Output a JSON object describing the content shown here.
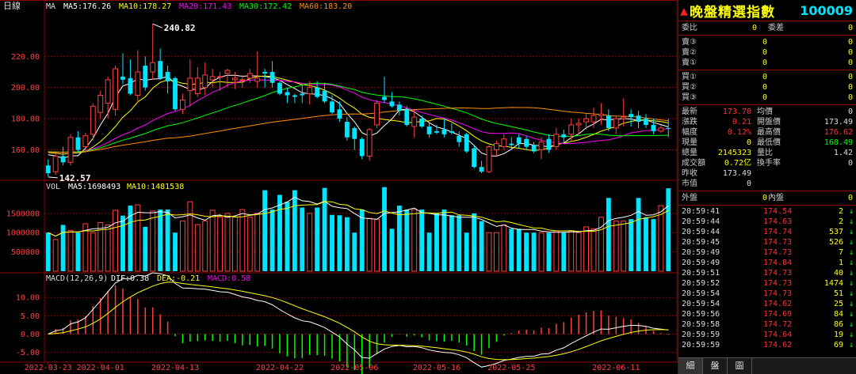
{
  "chart_data": {
    "type": "candlestick",
    "price_chart": {
      "period_label": "日線",
      "indicator_label": "MA",
      "ma_legend": [
        {
          "label": "MA5:176.26",
          "color": "#ffffff"
        },
        {
          "label": "MA10:178.27",
          "color": "#ffff00"
        },
        {
          "label": "MA20:171.43",
          "color": "#ff00ff"
        },
        {
          "label": "MA30:172.42",
          "color": "#00ff00"
        },
        {
          "label": "MA60:183.20",
          "color": "#ff8c00"
        }
      ],
      "ylim": [
        142,
        246
      ],
      "yticks": [
        160,
        180,
        200,
        220
      ],
      "ytick_labels": [
        "160.00",
        "180.00",
        "200.00",
        "220.00"
      ],
      "high_annotation": {
        "label": "240.82",
        "value": 240.82,
        "index": 14
      },
      "low_annotation": {
        "label": "142.57",
        "value": 142.57,
        "index": 0
      },
      "candles": [
        {
          "o": 150,
          "h": 154,
          "l": 143,
          "c": 145
        },
        {
          "o": 146,
          "h": 158,
          "l": 144,
          "c": 156
        },
        {
          "o": 156,
          "h": 162,
          "l": 150,
          "c": 152
        },
        {
          "o": 152,
          "h": 170,
          "l": 150,
          "c": 168
        },
        {
          "o": 168,
          "h": 172,
          "l": 158,
          "c": 160
        },
        {
          "o": 162,
          "h": 171,
          "l": 158,
          "c": 169
        },
        {
          "o": 170,
          "h": 190,
          "l": 166,
          "c": 188
        },
        {
          "o": 184,
          "h": 198,
          "l": 180,
          "c": 195
        },
        {
          "o": 190,
          "h": 207,
          "l": 180,
          "c": 205
        },
        {
          "o": 186,
          "h": 214,
          "l": 182,
          "c": 212
        },
        {
          "o": 207,
          "h": 222,
          "l": 202,
          "c": 205
        },
        {
          "o": 206,
          "h": 218,
          "l": 195,
          "c": 196
        },
        {
          "o": 195,
          "h": 224,
          "l": 190,
          "c": 210
        },
        {
          "o": 214,
          "h": 220,
          "l": 198,
          "c": 200
        },
        {
          "o": 210,
          "h": 241,
          "l": 205,
          "c": 216
        },
        {
          "o": 217,
          "h": 225,
          "l": 205,
          "c": 206
        },
        {
          "o": 210,
          "h": 214,
          "l": 196,
          "c": 204
        },
        {
          "o": 206,
          "h": 207,
          "l": 185,
          "c": 186
        },
        {
          "o": 186,
          "h": 196,
          "l": 183,
          "c": 192
        },
        {
          "o": 198,
          "h": 218,
          "l": 188,
          "c": 206
        },
        {
          "o": 196,
          "h": 213,
          "l": 194,
          "c": 206
        },
        {
          "o": 200,
          "h": 216,
          "l": 195,
          "c": 208
        },
        {
          "o": 205,
          "h": 212,
          "l": 200,
          "c": 207
        },
        {
          "o": 207,
          "h": 210,
          "l": 198,
          "c": 207
        },
        {
          "o": 209,
          "h": 212,
          "l": 200,
          "c": 211
        },
        {
          "o": 205,
          "h": 210,
          "l": 199,
          "c": 206
        },
        {
          "o": 205,
          "h": 208,
          "l": 200,
          "c": 205
        },
        {
          "o": 206,
          "h": 212,
          "l": 203,
          "c": 209
        },
        {
          "o": 204,
          "h": 223,
          "l": 200,
          "c": 206
        },
        {
          "o": 210,
          "h": 212,
          "l": 200,
          "c": 209
        },
        {
          "o": 210,
          "h": 217,
          "l": 200,
          "c": 203
        },
        {
          "o": 203,
          "h": 204,
          "l": 195,
          "c": 196
        },
        {
          "o": 197,
          "h": 200,
          "l": 190,
          "c": 195
        },
        {
          "o": 195,
          "h": 196,
          "l": 190,
          "c": 194
        },
        {
          "o": 196,
          "h": 202,
          "l": 190,
          "c": 195
        },
        {
          "o": 196,
          "h": 204,
          "l": 189,
          "c": 200
        },
        {
          "o": 200,
          "h": 204,
          "l": 193,
          "c": 194
        },
        {
          "o": 198,
          "h": 203,
          "l": 190,
          "c": 191
        },
        {
          "o": 191,
          "h": 195,
          "l": 183,
          "c": 184
        },
        {
          "o": 186,
          "h": 191,
          "l": 178,
          "c": 180
        },
        {
          "o": 178,
          "h": 181,
          "l": 166,
          "c": 168
        },
        {
          "o": 174,
          "h": 175,
          "l": 160,
          "c": 167
        },
        {
          "o": 167,
          "h": 168,
          "l": 154,
          "c": 156
        },
        {
          "o": 156,
          "h": 174,
          "l": 153,
          "c": 173
        },
        {
          "o": 176,
          "h": 192,
          "l": 174,
          "c": 190
        },
        {
          "o": 194,
          "h": 207,
          "l": 190,
          "c": 192
        },
        {
          "o": 191,
          "h": 197,
          "l": 187,
          "c": 188
        },
        {
          "o": 189,
          "h": 191,
          "l": 182,
          "c": 185
        },
        {
          "o": 186,
          "h": 188,
          "l": 175,
          "c": 176
        },
        {
          "o": 175,
          "h": 186,
          "l": 168,
          "c": 181
        },
        {
          "o": 180,
          "h": 182,
          "l": 174,
          "c": 175
        },
        {
          "o": 175,
          "h": 177,
          "l": 168,
          "c": 170
        },
        {
          "o": 172,
          "h": 176,
          "l": 170,
          "c": 171
        },
        {
          "o": 173,
          "h": 180,
          "l": 168,
          "c": 170
        },
        {
          "o": 172,
          "h": 177,
          "l": 170,
          "c": 171
        },
        {
          "o": 169,
          "h": 172,
          "l": 162,
          "c": 165
        },
        {
          "o": 170,
          "h": 171,
          "l": 158,
          "c": 159
        },
        {
          "o": 161,
          "h": 163,
          "l": 148,
          "c": 149
        },
        {
          "o": 149,
          "h": 153,
          "l": 145,
          "c": 146
        },
        {
          "o": 146,
          "h": 163,
          "l": 145,
          "c": 162
        },
        {
          "o": 160,
          "h": 166,
          "l": 156,
          "c": 164
        },
        {
          "o": 162,
          "h": 170,
          "l": 160,
          "c": 167
        },
        {
          "o": 164,
          "h": 168,
          "l": 160,
          "c": 163
        },
        {
          "o": 168,
          "h": 170,
          "l": 161,
          "c": 164
        },
        {
          "o": 167,
          "h": 169,
          "l": 160,
          "c": 162
        },
        {
          "o": 163,
          "h": 165,
          "l": 158,
          "c": 159
        },
        {
          "o": 160,
          "h": 168,
          "l": 154,
          "c": 165
        },
        {
          "o": 167,
          "h": 170,
          "l": 158,
          "c": 160
        },
        {
          "o": 162,
          "h": 174,
          "l": 160,
          "c": 170
        },
        {
          "o": 170,
          "h": 173,
          "l": 164,
          "c": 168
        },
        {
          "o": 170,
          "h": 180,
          "l": 166,
          "c": 176
        },
        {
          "o": 176,
          "h": 180,
          "l": 170,
          "c": 177
        },
        {
          "o": 178,
          "h": 183,
          "l": 173,
          "c": 180
        },
        {
          "o": 178,
          "h": 187,
          "l": 174,
          "c": 182
        },
        {
          "o": 182,
          "h": 190,
          "l": 176,
          "c": 183
        },
        {
          "o": 182,
          "h": 186,
          "l": 172,
          "c": 174
        },
        {
          "o": 174,
          "h": 182,
          "l": 170,
          "c": 180
        },
        {
          "o": 180,
          "h": 193,
          "l": 175,
          "c": 181
        },
        {
          "o": 183,
          "h": 186,
          "l": 175,
          "c": 181
        },
        {
          "o": 182,
          "h": 185,
          "l": 174,
          "c": 178
        },
        {
          "o": 180,
          "h": 183,
          "l": 174,
          "c": 176
        },
        {
          "o": 176,
          "h": 180,
          "l": 170,
          "c": 172
        },
        {
          "o": 172,
          "h": 176,
          "l": 171,
          "c": 174
        },
        {
          "o": 174,
          "h": 180,
          "l": 168,
          "c": 173.7
        }
      ]
    },
    "volume_chart": {
      "indicator_label": "VOL",
      "legend": [
        {
          "label": "MA5:1698493",
          "color": "#ffffff"
        },
        {
          "label": "MA10:1481538",
          "color": "#ffff00"
        }
      ],
      "ylim": [
        0,
        2050000
      ],
      "yticks": [
        500000,
        1000000,
        1500000
      ],
      "ytick_labels": [
        "500000",
        "1000000",
        "1500000"
      ],
      "values": [
        1000000,
        820000,
        1200000,
        1060000,
        1000000,
        1230000,
        1000000,
        1260000,
        1200000,
        1580000,
        1440000,
        1700000,
        1720000,
        1150000,
        1560000,
        1600000,
        1600000,
        1000000,
        1300000,
        1800000,
        1210000,
        1300000,
        1580000,
        1400000,
        1500000,
        1400000,
        1600000,
        1400000,
        1500000,
        2100000,
        1600000,
        1980000,
        1800000,
        2100000,
        1650000,
        1500000,
        1650000,
        2160000,
        1460000,
        1450000,
        1400000,
        1000000,
        1600000,
        1370000,
        1350000,
        2180000,
        1100000,
        1700000,
        1600000,
        1600000,
        1600000,
        1000000,
        1500000,
        1600000,
        1450000,
        1450000,
        1000000,
        1500000,
        1300000,
        1000000,
        1000000,
        1200000,
        1100000,
        1100000,
        1000000,
        1000000,
        1000000,
        1000000,
        1050000,
        1000000,
        1050000,
        1000000,
        1150000,
        1100000,
        1400000,
        1900000,
        1300000,
        1300000,
        1350000,
        1900000,
        1400000,
        1350000,
        1700000,
        2150000
      ],
      "up_color": "#ff4040",
      "down_color": "#00e5ff"
    },
    "macd_chart": {
      "indicator_label": "MACD(12,26,9)",
      "legend": [
        {
          "label": "DIF:0.38",
          "color": "#ffffff"
        },
        {
          "label": "DEA:-0.21",
          "color": "#ffff00"
        },
        {
          "label": "MACD:0.58",
          "color": "#ff00ff"
        }
      ],
      "ylim": [
        -6.6,
        13.5
      ],
      "yticks": [
        -5,
        0,
        5,
        10
      ],
      "ytick_labels": [
        "-5.00",
        "0.00",
        "5.00",
        "10.00"
      ]
    },
    "x_labels": [
      {
        "label": "2022-03-23",
        "index": 0
      },
      {
        "label": "2022-04-01",
        "index": 7
      },
      {
        "label": "2022-04-13",
        "index": 17
      },
      {
        "label": "2022-04-22",
        "index": 31
      },
      {
        "label": "2022-05-06",
        "index": 41
      },
      {
        "label": "2022-05-16",
        "index": 52
      },
      {
        "label": "2022-05-25",
        "index": 62
      },
      {
        "label": "2022-06-11",
        "index": 76
      }
    ]
  },
  "panel": {
    "title": "晚盤精選指數",
    "code": "100009",
    "orderbook": {
      "ratio_label": "委比",
      "ratio_value": "0",
      "diff_label": "委差",
      "diff_value": "0",
      "asks": [
        {
          "label": "賣③",
          "price": "0",
          "vol": "0"
        },
        {
          "label": "賣②",
          "price": "0",
          "vol": "0"
        },
        {
          "label": "賣①",
          "price": "0",
          "vol": "0"
        }
      ],
      "bids": [
        {
          "label": "買①",
          "price": "0",
          "vol": "0"
        },
        {
          "label": "買②",
          "price": "0",
          "vol": "0"
        },
        {
          "label": "買③",
          "price": "0",
          "vol": "0"
        }
      ]
    },
    "quote": [
      {
        "l1": "最新",
        "v1": "173.70",
        "c1": "red",
        "l2": "均價",
        "v2": "0",
        "c2": "wht"
      },
      {
        "l1": "漲跌",
        "v1": "0.21",
        "c1": "red",
        "l2": "開盤價",
        "v2": "173.49",
        "c2": "wht"
      },
      {
        "l1": "幅度",
        "v1": "0.12%",
        "c1": "red",
        "l2": "最高價",
        "v2": "176.62",
        "c2": "red"
      },
      {
        "l1": "現量",
        "v1": "0",
        "c1": "yel",
        "l2": "最低價",
        "v2": "168.49",
        "c2": "grn"
      },
      {
        "l1": "總量",
        "v1": "2145323",
        "c1": "yel",
        "l2": "量比",
        "v2": "1.42",
        "c2": "wht"
      },
      {
        "l1": "成交額",
        "v1": "0.72亿",
        "c1": "yel",
        "l2": "換手率",
        "v2": "0",
        "c2": "wht"
      },
      {
        "l1": "昨收",
        "v1": "173.49",
        "c1": "wht",
        "l2": "",
        "v2": "",
        "c2": "wht"
      },
      {
        "l1": "市值",
        "v1": "0",
        "c1": "wht",
        "l2": "",
        "v2": "",
        "c2": "wht"
      }
    ],
    "outer": {
      "label": "外盤",
      "value": "0",
      "inner_label": "內盤",
      "inner_value": "0"
    },
    "ticks": [
      {
        "time": "20:59:41",
        "price": "174.54",
        "vol": "2"
      },
      {
        "time": "20:59:44",
        "price": "174.63",
        "vol": "2"
      },
      {
        "time": "20:59:44",
        "price": "174.74",
        "vol": "537"
      },
      {
        "time": "20:59:45",
        "price": "174.73",
        "vol": "526"
      },
      {
        "time": "20:59:49",
        "price": "174.73",
        "vol": "7"
      },
      {
        "time": "20:59:49",
        "price": "174.84",
        "vol": "1"
      },
      {
        "time": "20:59:51",
        "price": "174.73",
        "vol": "40"
      },
      {
        "time": "20:59:52",
        "price": "174.73",
        "vol": "1474"
      },
      {
        "time": "20:59:54",
        "price": "174.73",
        "vol": "51"
      },
      {
        "time": "20:59:54",
        "price": "174.62",
        "vol": "25"
      },
      {
        "time": "20:59:56",
        "price": "174.69",
        "vol": "84"
      },
      {
        "time": "20:59:58",
        "price": "174.72",
        "vol": "86"
      },
      {
        "time": "20:59:59",
        "price": "174.64",
        "vol": "19"
      },
      {
        "time": "20:59:59",
        "price": "174.62",
        "vol": "69"
      }
    ],
    "tick_arrow": "↓",
    "tabs": [
      "細",
      "盤",
      "圖"
    ]
  }
}
